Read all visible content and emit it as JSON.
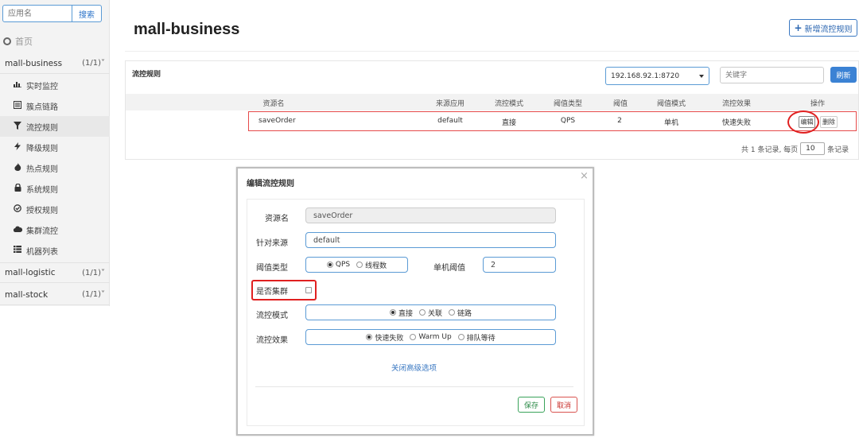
{
  "sidebar": {
    "search_placeholder": "应用名",
    "search_button": "搜索",
    "home_label": "首页",
    "apps": [
      {
        "name": "mall-business",
        "count": "(1/1)˅"
      },
      {
        "name": "mall-logistic",
        "count": "(1/1)˅"
      },
      {
        "name": "mall-stock",
        "count": "(1/1)˅"
      }
    ],
    "menu": [
      {
        "label": "实时监控",
        "icon": "bar-chart-icon"
      },
      {
        "label": "簇点链路",
        "icon": "list-icon"
      },
      {
        "label": "流控规则",
        "icon": "filter-icon",
        "active": true
      },
      {
        "label": "降级规则",
        "icon": "bolt-icon"
      },
      {
        "label": "热点规则",
        "icon": "fire-icon"
      },
      {
        "label": "系统规则",
        "icon": "lock-icon"
      },
      {
        "label": "授权规则",
        "icon": "check-circle-icon"
      },
      {
        "label": "集群流控",
        "icon": "cloud-icon"
      },
      {
        "label": "机器列表",
        "icon": "th-list-icon"
      }
    ]
  },
  "main": {
    "title": "mall-business",
    "add_button": "新增流控规则",
    "panel_title": "流控规则",
    "machine": "192.168.92.1:8720",
    "keyword_placeholder": "关键字",
    "refresh_button": "刷新",
    "columns": [
      "资源名",
      "来源应用",
      "流控模式",
      "阈值类型",
      "阈值",
      "阈值模式",
      "流控效果",
      "操作"
    ],
    "row": {
      "resource": "saveOrder",
      "source": "default",
      "mode": "直接",
      "threshold_type": "QPS",
      "threshold": "2",
      "threshold_mode": "单机",
      "effect": "快速失败",
      "edit": "编辑",
      "delete": "删除"
    },
    "pager": {
      "prefix": "共 1 条记录, 每页",
      "page_size": "10",
      "suffix": "条记录"
    }
  },
  "modal": {
    "title": "编辑流控规则",
    "close": "×",
    "resource_label": "资源名",
    "resource_value": "saveOrder",
    "source_label": "针对来源",
    "source_value": "default",
    "threshold_type_label": "阈值类型",
    "threshold_type_options": [
      "QPS",
      "线程数"
    ],
    "threshold_label": "单机阈值",
    "threshold_value": "2",
    "cluster_label": "是否集群",
    "mode_label": "流控模式",
    "mode_options": [
      "直接",
      "关联",
      "链路"
    ],
    "effect_label": "流控效果",
    "effect_options": [
      "快速失败",
      "Warm Up",
      "排队等待"
    ],
    "advanced_link": "关闭高级选项",
    "save_button": "保存",
    "cancel_button": "取消"
  },
  "colors": {
    "primary": "#3b82d4",
    "highlight_red": "#e02020",
    "save_green": "#2e8b4a"
  }
}
